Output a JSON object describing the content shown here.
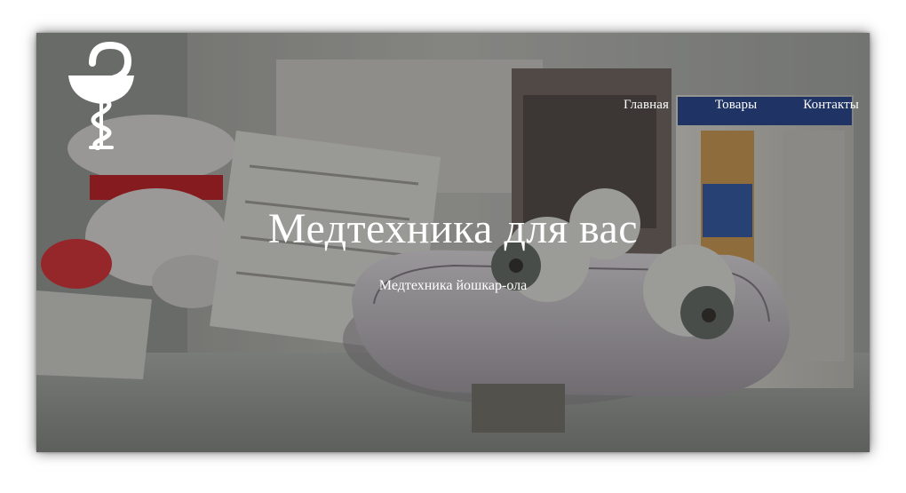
{
  "nav": {
    "items": [
      {
        "label": "Главная"
      },
      {
        "label": "Товары"
      },
      {
        "label": "Контакты"
      }
    ]
  },
  "hero": {
    "title": "Медтехника для вас",
    "subtitle": "Медтехника йошкар-ола"
  },
  "logo": {
    "icon": "bowl-of-hygieia-icon"
  },
  "colors": {
    "text": "#ffffff",
    "overlay": "rgba(0,0,0,0.34)",
    "box_accent": "#2f4f9a",
    "massager_body": "#c9c4c8"
  }
}
